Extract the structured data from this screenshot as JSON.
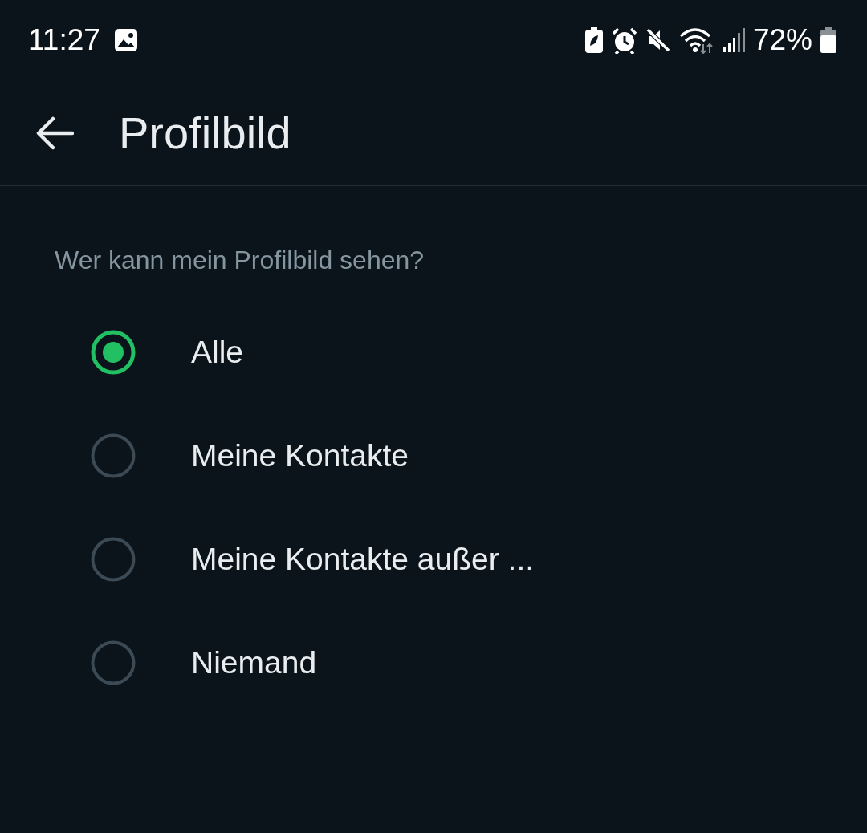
{
  "status_bar": {
    "time": "11:27",
    "battery": "72%"
  },
  "app_bar": {
    "title": "Profilbild"
  },
  "question": "Wer kann mein Profilbild sehen?",
  "options": [
    {
      "label": "Alle",
      "selected": true
    },
    {
      "label": "Meine Kontakte",
      "selected": false
    },
    {
      "label": "Meine Kontakte außer ...",
      "selected": false
    },
    {
      "label": "Niemand",
      "selected": false
    }
  ]
}
